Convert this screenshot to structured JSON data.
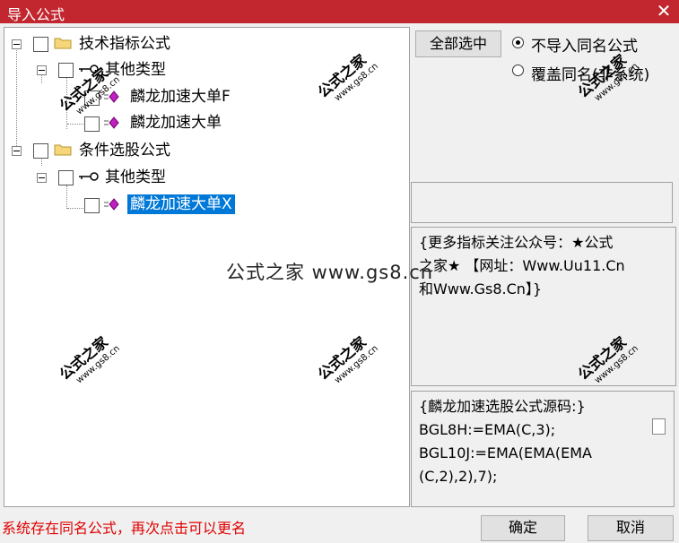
{
  "window": {
    "title": "导入公式",
    "close_glyph": "✕"
  },
  "tree": {
    "nodes": [
      {
        "label": "技术指标公式"
      },
      {
        "label": "其他类型"
      },
      {
        "label": "麟龙加速大单F"
      },
      {
        "label": "麟龙加速大单"
      },
      {
        "label": "条件选股公式"
      },
      {
        "label": "其他类型"
      },
      {
        "label": "麟龙加速大单X"
      }
    ]
  },
  "buttons": {
    "select_all": "全部选中",
    "ok": "确定",
    "cancel": "取消"
  },
  "options": {
    "no_import": "不导入同名公式",
    "overwrite": "覆盖同名(非系统)",
    "selected": "no_import"
  },
  "info_panel": {
    "lines": [
      "{更多指标关注公众号：★公式",
      "之家★ 【网址：Www.Uu11.Cn",
      "和Www.Gs8.Cn】}"
    ]
  },
  "source_panel": {
    "lines": [
      "{麟龙加速选股公式源码:}",
      "BGL8H:=EMA(C,3);",
      "BGL10J:=EMA(EMA(EMA",
      "(C,2),2),7);"
    ]
  },
  "status": "系统存在同名公式，再次点击可以更名",
  "watermark": {
    "label": "公式之家",
    "url": "www.gs8.cn",
    "banner": "公式之家 www.gs8.cn"
  }
}
